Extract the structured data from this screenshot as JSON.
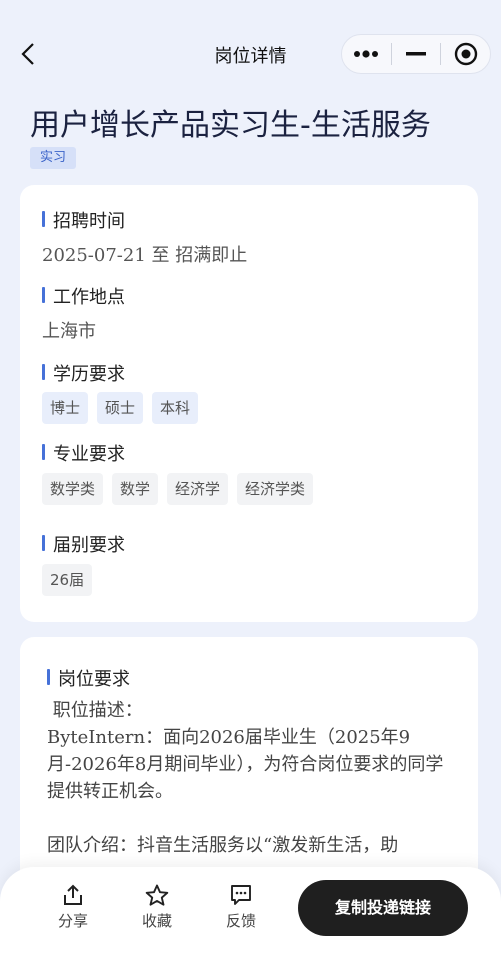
{
  "nav": {
    "title": "岗位详情"
  },
  "job": {
    "title": "用户增长产品实习生-生活服务",
    "type_tag": "实习"
  },
  "recruit_time": {
    "label": "招聘时间",
    "value": "2025-07-21 至 招满即止"
  },
  "location": {
    "label": "工作地点",
    "value": "上海市"
  },
  "education": {
    "label": "学历要求",
    "items": [
      "博士",
      "硕士",
      "本科"
    ]
  },
  "major": {
    "label": "专业要求",
    "items": [
      "数学类",
      "数学",
      "经济学",
      "经济学类"
    ]
  },
  "graduation": {
    "label": "届别要求",
    "items": [
      "26届"
    ]
  },
  "requirements": {
    "label": "岗位要求",
    "desc_heading": " 职位描述：",
    "desc_intro": "ByteIntern：面向2026届毕业生（2025年9月-2026年8月期间毕业），为符合岗位要求的同学提供转正机会。",
    "team_intro": "团队介绍：抖音生活服务以“激发新生活，助"
  },
  "bottom_bar": {
    "share": "分享",
    "favorite": "收藏",
    "feedback": "反馈",
    "apply": "复制投递链接"
  }
}
